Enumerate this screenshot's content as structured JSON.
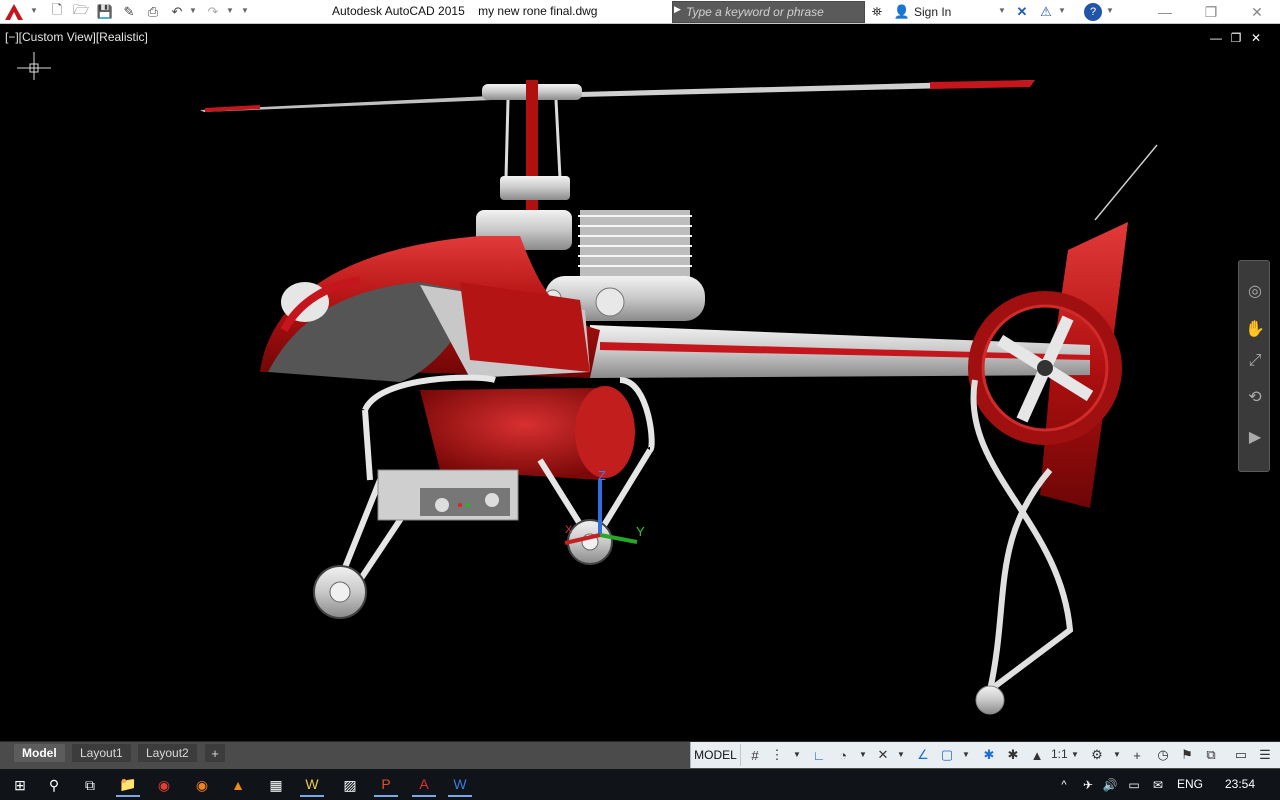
{
  "window": {
    "title": "Autodesk AutoCAD 2015    my new rone final.dwg",
    "search_placeholder": "Type a keyword or phrase",
    "sign_in": "Sign In"
  },
  "viewport": {
    "label": "[−][Custom View][Realistic]",
    "ucs_x": "X",
    "ucs_y": "Y",
    "ucs_z": "Z"
  },
  "layout_tabs": {
    "model": "Model",
    "layout1": "Layout1",
    "layout2": "Layout2",
    "add": "+"
  },
  "status_bar": {
    "model": "MODEL",
    "scale": "1:1"
  },
  "taskbar": {
    "language": "ENG",
    "time": "23:54"
  },
  "colors": {
    "accent_red": "#c4161c",
    "viewport_bg": "#000000",
    "helicopter_body": "#b01010",
    "helicopter_metal": "#d9d9d9"
  }
}
